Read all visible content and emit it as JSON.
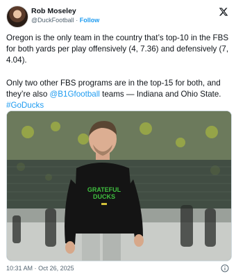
{
  "author": {
    "name": "Rob Moseley",
    "handle": "@DuckFootball",
    "separator": "·",
    "follow_label": "Follow"
  },
  "tweet": {
    "p1": "Oregon is the only team in the country that’s top-10 in the FBS for both yards per play offensively (4, 7.36) and defensively (7, 4.04).",
    "p2_a": "Only two other FBS programs are in the top-15 for both, and they’re also ",
    "p2_mention": "@B1Gfootball",
    "p2_b": " teams — Indiana and Ohio State. ",
    "p2_hashtag": "#GoDucks"
  },
  "photo": {
    "hoodie_line1": "GRATEFUL",
    "hoodie_line2": "DUCKS",
    "colors": {
      "hoodie": "#141414",
      "hoodie_text": "#3fbf3f",
      "pants": "#b9bdb9"
    }
  },
  "footer": {
    "time": "10:31 AM",
    "separator": "·",
    "date": "Oct 26, 2025"
  },
  "icons": [
    "x-logo-icon",
    "info-icon"
  ],
  "colors": {
    "link": "#1d9bf0",
    "muted": "#536471",
    "text": "#0f1419"
  }
}
